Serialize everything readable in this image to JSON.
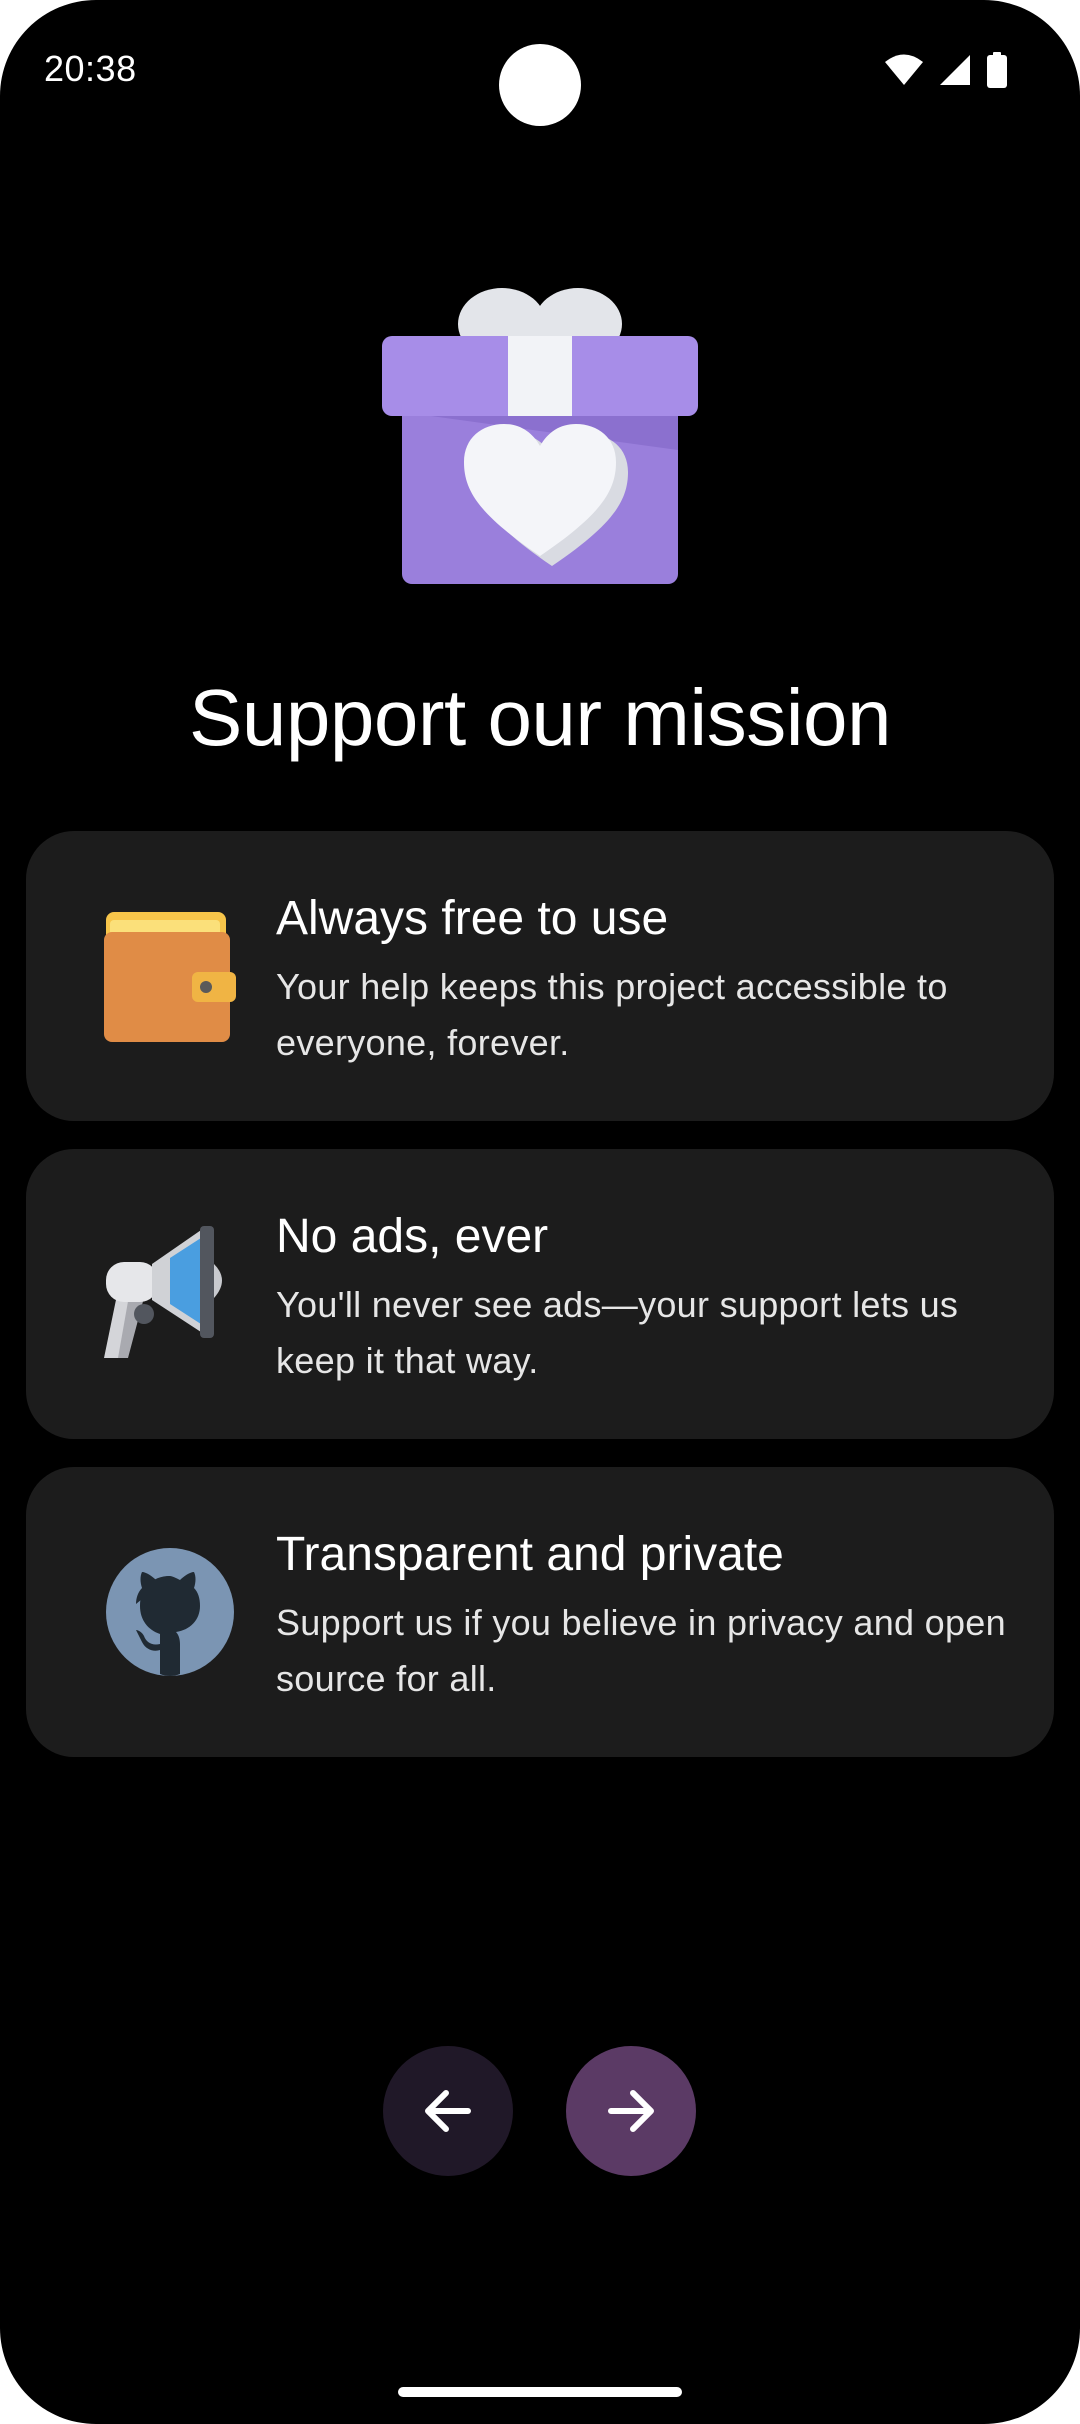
{
  "status_bar": {
    "time": "20:38",
    "icons": [
      "wifi-icon",
      "cellular-signal-icon",
      "battery-icon"
    ]
  },
  "hero": {
    "icon": "gift-heart-icon"
  },
  "title": "Support our mission",
  "cards": [
    {
      "icon": "wallet-icon",
      "title": "Always free to use",
      "description": "Your help keeps this project accessible to everyone, forever."
    },
    {
      "icon": "megaphone-icon",
      "title": "No ads, ever",
      "description": "You'll never see ads—your support lets us keep it that way."
    },
    {
      "icon": "github-icon",
      "title": "Transparent and private",
      "description": "Support us if you believe in privacy and open source for all."
    }
  ],
  "navigation": {
    "back_icon": "arrow-left-icon",
    "next_icon": "arrow-right-icon"
  },
  "colors": {
    "background": "#000000",
    "card_background": "#1c1c1c",
    "back_button": "#201828",
    "next_button": "#5b3a65",
    "gift_purple": "#a78de8"
  }
}
